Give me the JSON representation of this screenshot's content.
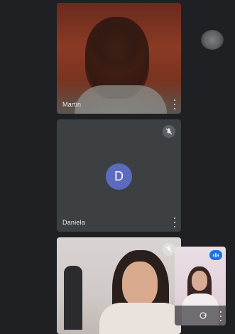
{
  "participants": [
    {
      "name": "Martin"
    },
    {
      "name": "Daniela",
      "initial": "D",
      "avatar_color": "#5c6bc0"
    },
    {
      "name": ""
    }
  ],
  "self_view": {
    "status": "speaking"
  },
  "colors": {
    "background": "#202124",
    "tile": "#3c4043",
    "accent": "#1a73e8"
  },
  "icons": [
    "mic-off-icon",
    "more-vert-icon",
    "speaking-icon",
    "switch-camera-icon"
  ]
}
